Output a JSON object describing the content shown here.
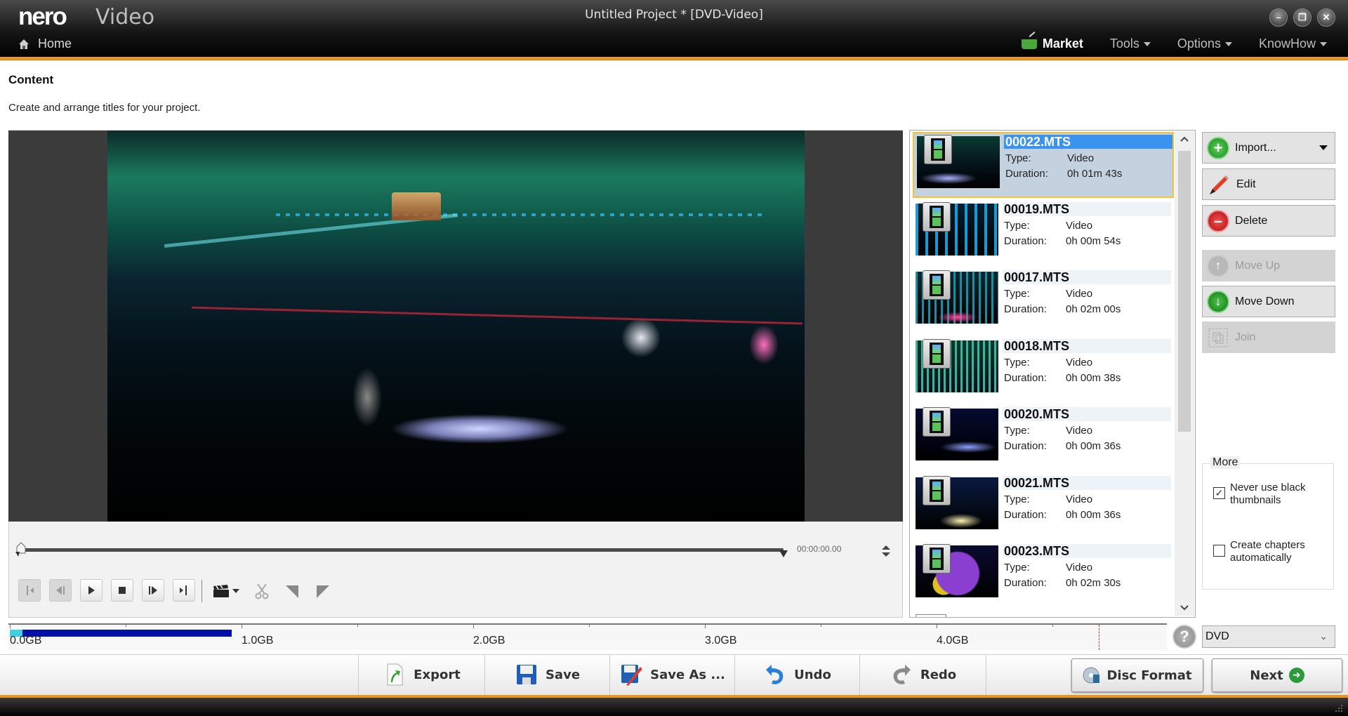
{
  "app": {
    "logo_brand": "nero",
    "logo_product": "Video",
    "window_title": "Untitled Project * [DVD-Video]",
    "home_label": "Home",
    "window_controls": {
      "minimize": "–",
      "restore": "❐",
      "close": "✕"
    }
  },
  "menu": {
    "market": "Market",
    "tools": "Tools",
    "options": "Options",
    "knowhow": "KnowHow"
  },
  "content": {
    "title": "Content",
    "description": "Create and arrange titles for your project."
  },
  "player": {
    "timecode": "00:00:00.00",
    "position_fraction": 0.0,
    "controls": [
      "go-to-start",
      "previous-frame",
      "play",
      "stop",
      "next-frame",
      "go-to-end",
      "chapter-clapper",
      "cut",
      "set-marker-in",
      "set-marker-out"
    ]
  },
  "file_list": {
    "items": [
      {
        "name": "00022.MTS",
        "type_label": "Type:",
        "type": "Video",
        "duration_label": "Duration:",
        "duration": "0h 01m 43s",
        "selected": true
      },
      {
        "name": "00019.MTS",
        "type_label": "Type:",
        "type": "Video",
        "duration_label": "Duration:",
        "duration": "0h 00m 54s",
        "selected": false
      },
      {
        "name": "00017.MTS",
        "type_label": "Type:",
        "type": "Video",
        "duration_label": "Duration:",
        "duration": "0h 02m 00s",
        "selected": false
      },
      {
        "name": "00018.MTS",
        "type_label": "Type:",
        "type": "Video",
        "duration_label": "Duration:",
        "duration": "0h 00m 38s",
        "selected": false
      },
      {
        "name": "00020.MTS",
        "type_label": "Type:",
        "type": "Video",
        "duration_label": "Duration:",
        "duration": "0h 00m 36s",
        "selected": false
      },
      {
        "name": "00021.MTS",
        "type_label": "Type:",
        "type": "Video",
        "duration_label": "Duration:",
        "duration": "0h 00m 36s",
        "selected": false
      },
      {
        "name": "00023.MTS",
        "type_label": "Type:",
        "type": "Video",
        "duration_label": "Duration:",
        "duration": "0h 02m 30s",
        "selected": false
      }
    ]
  },
  "actions": {
    "import": "Import...",
    "edit": "Edit",
    "delete": "Delete",
    "move_up": "Move Up",
    "move_down": "Move Down",
    "join": "Join"
  },
  "more": {
    "title": "More",
    "never_black_thumbnails": {
      "label": "Never use black thumbnails",
      "checked": true
    },
    "create_chapters": {
      "label": "Create chapters automatically",
      "checked": false
    }
  },
  "capacity": {
    "labels": [
      "0.0GB",
      "1.0GB",
      "2.0GB",
      "3.0GB",
      "4.0GB"
    ],
    "used_gb": 0.95,
    "limit_gb": 4.7,
    "disc_type": "DVD",
    "help": "?"
  },
  "toolbar": {
    "export": "Export",
    "save": "Save",
    "save_as": "Save As ...",
    "undo": "Undo",
    "redo": "Redo",
    "disc_format": "Disc Format",
    "next": "Next"
  }
}
